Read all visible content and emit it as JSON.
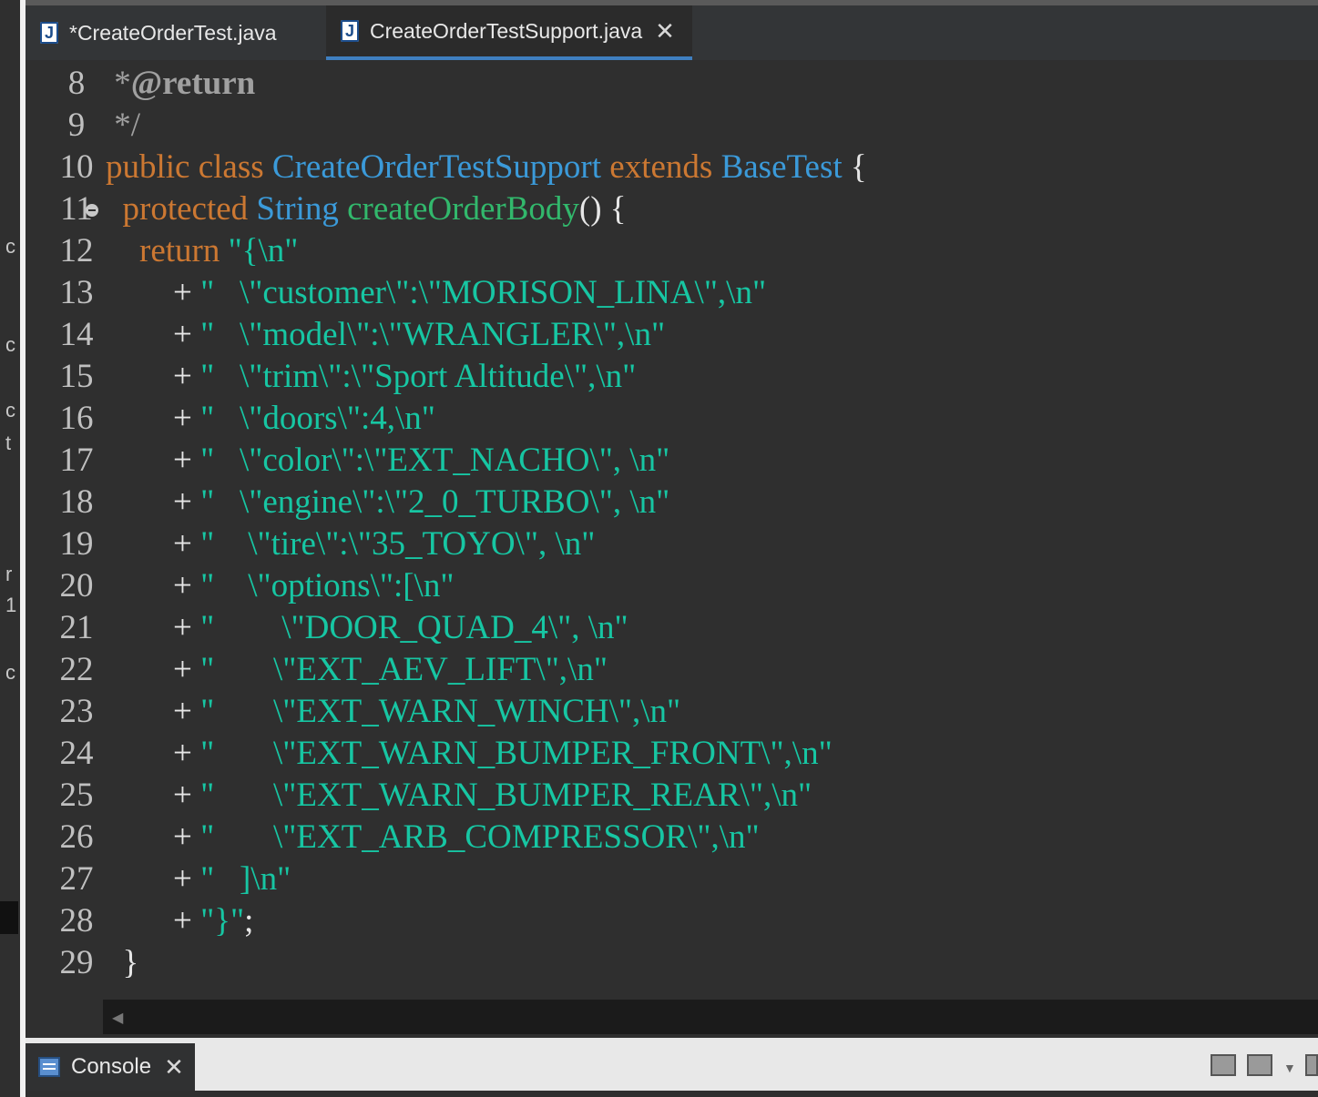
{
  "tabs": [
    {
      "label": "*CreateOrderTest.java",
      "active": false
    },
    {
      "label": "CreateOrderTestSupport.java",
      "active": true
    }
  ],
  "left_strip_chars": [
    "c",
    "c",
    "c",
    "t",
    "r",
    "1",
    "c"
  ],
  "code": {
    "lines": [
      {
        "num": "8",
        "parts": [
          [
            "cm",
            " *"
          ],
          [
            "an",
            "@return"
          ]
        ]
      },
      {
        "num": "9",
        "parts": [
          [
            "cm",
            " */"
          ]
        ]
      },
      {
        "num": "10",
        "parts": [
          [
            "kw",
            "public class "
          ],
          [
            "ty",
            "CreateOrderTestSupport"
          ],
          [
            "kw",
            " extends "
          ],
          [
            "ty",
            "BaseTest"
          ],
          [
            "pl",
            " {"
          ]
        ]
      },
      {
        "num": "11",
        "fold": true,
        "parts": [
          [
            "kw",
            "  protected "
          ],
          [
            "ty",
            "String"
          ],
          [
            "pl",
            " "
          ],
          [
            "fn",
            "createOrderBody"
          ],
          [
            "pl",
            "() {"
          ]
        ]
      },
      {
        "num": "12",
        "parts": [
          [
            "kw",
            "    return "
          ],
          [
            "st",
            "\"{\\n\""
          ]
        ]
      },
      {
        "num": "13",
        "parts": [
          [
            "pl",
            "        + "
          ],
          [
            "st",
            "\"   \\\"customer\\\":\\\"MORISON_LINA\\\",\\n\""
          ]
        ]
      },
      {
        "num": "14",
        "parts": [
          [
            "pl",
            "        + "
          ],
          [
            "st",
            "\"   \\\"model\\\":\\\"WRANGLER\\\",\\n\""
          ]
        ]
      },
      {
        "num": "15",
        "parts": [
          [
            "pl",
            "        + "
          ],
          [
            "st",
            "\"   \\\"trim\\\":\\\"Sport Altitude\\\",\\n\""
          ]
        ]
      },
      {
        "num": "16",
        "parts": [
          [
            "pl",
            "        + "
          ],
          [
            "st",
            "\"   \\\"doors\\\":4,\\n\""
          ]
        ]
      },
      {
        "num": "17",
        "parts": [
          [
            "pl",
            "        + "
          ],
          [
            "st",
            "\"   \\\"color\\\":\\\"EXT_NACHO\\\", \\n\""
          ]
        ]
      },
      {
        "num": "18",
        "parts": [
          [
            "pl",
            "        + "
          ],
          [
            "st",
            "\"   \\\"engine\\\":\\\"2_0_TURBO\\\", \\n\""
          ]
        ]
      },
      {
        "num": "19",
        "parts": [
          [
            "pl",
            "        + "
          ],
          [
            "st",
            "\"    \\\"tire\\\":\\\"35_TOYO\\\", \\n\""
          ]
        ]
      },
      {
        "num": "20",
        "parts": [
          [
            "pl",
            "        + "
          ],
          [
            "st",
            "\"    \\\"options\\\":[\\n\""
          ]
        ]
      },
      {
        "num": "21",
        "parts": [
          [
            "pl",
            "        + "
          ],
          [
            "st",
            "\"        \\\"DOOR_QUAD_4\\\", \\n\""
          ]
        ]
      },
      {
        "num": "22",
        "parts": [
          [
            "pl",
            "        + "
          ],
          [
            "st",
            "\"       \\\"EXT_AEV_LIFT\\\",\\n\""
          ]
        ]
      },
      {
        "num": "23",
        "parts": [
          [
            "pl",
            "        + "
          ],
          [
            "st",
            "\"       \\\"EXT_WARN_WINCH\\\",\\n\""
          ]
        ]
      },
      {
        "num": "24",
        "parts": [
          [
            "pl",
            "        + "
          ],
          [
            "st",
            "\"       \\\"EXT_WARN_BUMPER_FRONT\\\",\\n\""
          ]
        ]
      },
      {
        "num": "25",
        "parts": [
          [
            "pl",
            "        + "
          ],
          [
            "st",
            "\"       \\\"EXT_WARN_BUMPER_REAR\\\",\\n\""
          ]
        ]
      },
      {
        "num": "26",
        "parts": [
          [
            "pl",
            "        + "
          ],
          [
            "st",
            "\"       \\\"EXT_ARB_COMPRESSOR\\\",\\n\""
          ]
        ]
      },
      {
        "num": "27",
        "parts": [
          [
            "pl",
            "        + "
          ],
          [
            "st",
            "\"   ]\\n\""
          ]
        ]
      },
      {
        "num": "28",
        "parts": [
          [
            "pl",
            "        + "
          ],
          [
            "st",
            "\"}\""
          ],
          [
            "pl",
            ";"
          ]
        ]
      },
      {
        "num": "29",
        "parts": [
          [
            "pl",
            "  }"
          ]
        ]
      }
    ]
  },
  "console": {
    "label": "Console"
  },
  "colors": {
    "keyword": "#cc7832",
    "type": "#3b9ad9",
    "method": "#32b86c",
    "string": "#17c6a3",
    "editor_bg": "#2f2f2f",
    "active_tab_underline": "#3f7fc0"
  },
  "icons": {
    "java_file": "java-file-icon",
    "close": "close-icon",
    "console": "console-icon",
    "fold": "fold-collapse-icon"
  }
}
